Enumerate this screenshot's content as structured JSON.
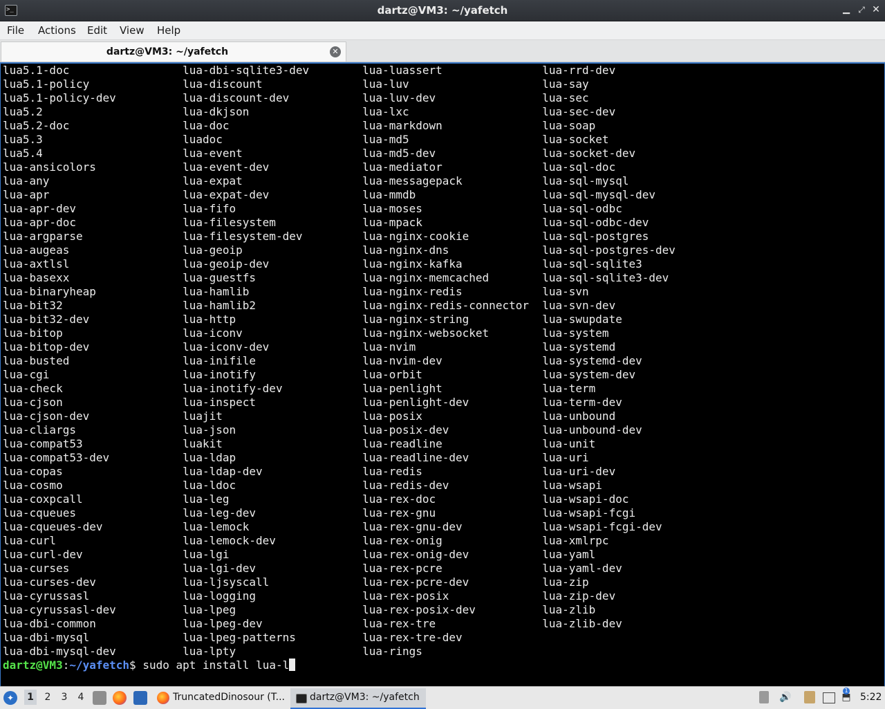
{
  "window": {
    "title": "dartz@VM3: ~/yafetch",
    "controls": {
      "minimize": "▁",
      "maximize": "⤢",
      "close": "✕"
    }
  },
  "menu": [
    "File",
    "Actions",
    "Edit",
    "View",
    "Help"
  ],
  "tab": {
    "label": "dartz@VM3: ~/yafetch",
    "close": "✕"
  },
  "terminal": {
    "rows": [
      [
        "lua5.1-doc",
        "lua-dbi-sqlite3-dev",
        "lua-luassert",
        "lua-rrd-dev"
      ],
      [
        "lua5.1-policy",
        "lua-discount",
        "lua-luv",
        "lua-say"
      ],
      [
        "lua5.1-policy-dev",
        "lua-discount-dev",
        "lua-luv-dev",
        "lua-sec"
      ],
      [
        "lua5.2",
        "lua-dkjson",
        "lua-lxc",
        "lua-sec-dev"
      ],
      [
        "lua5.2-doc",
        "lua-doc",
        "lua-markdown",
        "lua-soap"
      ],
      [
        "lua5.3",
        "luadoc",
        "lua-md5",
        "lua-socket"
      ],
      [
        "lua5.4",
        "lua-event",
        "lua-md5-dev",
        "lua-socket-dev"
      ],
      [
        "lua-ansicolors",
        "lua-event-dev",
        "lua-mediator",
        "lua-sql-doc"
      ],
      [
        "lua-any",
        "lua-expat",
        "lua-messagepack",
        "lua-sql-mysql"
      ],
      [
        "lua-apr",
        "lua-expat-dev",
        "lua-mmdb",
        "lua-sql-mysql-dev"
      ],
      [
        "lua-apr-dev",
        "lua-fifo",
        "lua-moses",
        "lua-sql-odbc"
      ],
      [
        "lua-apr-doc",
        "lua-filesystem",
        "lua-mpack",
        "lua-sql-odbc-dev"
      ],
      [
        "lua-argparse",
        "lua-filesystem-dev",
        "lua-nginx-cookie",
        "lua-sql-postgres"
      ],
      [
        "lua-augeas",
        "lua-geoip",
        "lua-nginx-dns",
        "lua-sql-postgres-dev"
      ],
      [
        "lua-axtlsl",
        "lua-geoip-dev",
        "lua-nginx-kafka",
        "lua-sql-sqlite3"
      ],
      [
        "lua-basexx",
        "lua-guestfs",
        "lua-nginx-memcached",
        "lua-sql-sqlite3-dev"
      ],
      [
        "lua-binaryheap",
        "lua-hamlib",
        "lua-nginx-redis",
        "lua-svn"
      ],
      [
        "lua-bit32",
        "lua-hamlib2",
        "lua-nginx-redis-connector",
        "lua-svn-dev"
      ],
      [
        "lua-bit32-dev",
        "lua-http",
        "lua-nginx-string",
        "lua-swupdate"
      ],
      [
        "lua-bitop",
        "lua-iconv",
        "lua-nginx-websocket",
        "lua-system"
      ],
      [
        "lua-bitop-dev",
        "lua-iconv-dev",
        "lua-nvim",
        "lua-systemd"
      ],
      [
        "lua-busted",
        "lua-inifile",
        "lua-nvim-dev",
        "lua-systemd-dev"
      ],
      [
        "lua-cgi",
        "lua-inotify",
        "lua-orbit",
        "lua-system-dev"
      ],
      [
        "lua-check",
        "lua-inotify-dev",
        "lua-penlight",
        "lua-term"
      ],
      [
        "lua-cjson",
        "lua-inspect",
        "lua-penlight-dev",
        "lua-term-dev"
      ],
      [
        "lua-cjson-dev",
        "luajit",
        "lua-posix",
        "lua-unbound"
      ],
      [
        "lua-cliargs",
        "lua-json",
        "lua-posix-dev",
        "lua-unbound-dev"
      ],
      [
        "lua-compat53",
        "luakit",
        "lua-readline",
        "lua-unit"
      ],
      [
        "lua-compat53-dev",
        "lua-ldap",
        "lua-readline-dev",
        "lua-uri"
      ],
      [
        "lua-copas",
        "lua-ldap-dev",
        "lua-redis",
        "lua-uri-dev"
      ],
      [
        "lua-cosmo",
        "lua-ldoc",
        "lua-redis-dev",
        "lua-wsapi"
      ],
      [
        "lua-coxpcall",
        "lua-leg",
        "lua-rex-doc",
        "lua-wsapi-doc"
      ],
      [
        "lua-cqueues",
        "lua-leg-dev",
        "lua-rex-gnu",
        "lua-wsapi-fcgi"
      ],
      [
        "lua-cqueues-dev",
        "lua-lemock",
        "lua-rex-gnu-dev",
        "lua-wsapi-fcgi-dev"
      ],
      [
        "lua-curl",
        "lua-lemock-dev",
        "lua-rex-onig",
        "lua-xmlrpc"
      ],
      [
        "lua-curl-dev",
        "lua-lgi",
        "lua-rex-onig-dev",
        "lua-yaml"
      ],
      [
        "lua-curses",
        "lua-lgi-dev",
        "lua-rex-pcre",
        "lua-yaml-dev"
      ],
      [
        "lua-curses-dev",
        "lua-ljsyscall",
        "lua-rex-pcre-dev",
        "lua-zip"
      ],
      [
        "lua-cyrussasl",
        "lua-logging",
        "lua-rex-posix",
        "lua-zip-dev"
      ],
      [
        "lua-cyrussasl-dev",
        "lua-lpeg",
        "lua-rex-posix-dev",
        "lua-zlib"
      ],
      [
        "lua-dbi-common",
        "lua-lpeg-dev",
        "lua-rex-tre",
        "lua-zlib-dev"
      ],
      [
        "lua-dbi-mysql",
        "lua-lpeg-patterns",
        "lua-rex-tre-dev",
        ""
      ],
      [
        "lua-dbi-mysql-dev",
        "lua-lpty",
        "lua-rings",
        ""
      ]
    ],
    "prompt": {
      "user": "dartz@VM3",
      "sep": ":",
      "path": "~/yafetch",
      "symbol": "$ ",
      "command": "sudo apt install lua-l"
    },
    "colors": {
      "user": "#55e34a",
      "path": "#5b8ff5",
      "text": "#ececec"
    }
  },
  "taskbar": {
    "start_icon": "start-menu-icon",
    "workspaces": [
      "1",
      "2",
      "3",
      "4"
    ],
    "tasks": [
      {
        "label": "TruncatedDinosour (T...",
        "icon": "firefox-icon"
      },
      {
        "label": "dartz@VM3: ~/yafetch",
        "icon": "terminal-icon"
      }
    ],
    "tray_badge": "1",
    "clock": "5:22"
  }
}
